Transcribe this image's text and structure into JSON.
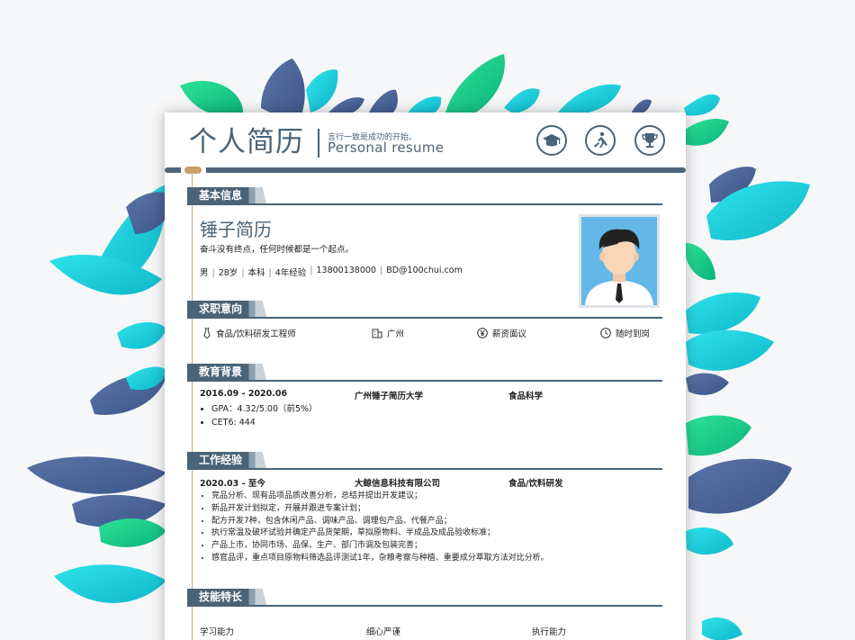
{
  "header": {
    "title_cn": "个人简历",
    "motto": "言行一致是成功的开始。",
    "title_en": "Personal resume",
    "badges": [
      "graduation-cap-icon",
      "runner-icon",
      "trophy-icon"
    ]
  },
  "sections": {
    "basic": "基本信息",
    "intent": "求职意向",
    "education": "教育背景",
    "work": "工作经验",
    "skills": "技能特长"
  },
  "basic": {
    "name": "锤子简历",
    "slogan": "奋斗没有终点，任何时候都是一个起点。",
    "info": [
      "男",
      "28岁",
      "本科",
      "4年经验",
      "13800138000",
      "BD@100chui.com"
    ]
  },
  "intent": {
    "position": "食品/饮料研发工程师",
    "city": "广州",
    "salary": "薪资面议",
    "availability": "随时到岗"
  },
  "education": {
    "period": "2016.09 - 2020.06",
    "school": "广州锤子简历大学",
    "major": "食品科学",
    "items": [
      "GPA：4.32/5.00（前5%）",
      "CET6: 444"
    ]
  },
  "work": {
    "period": "2020.03 - 至今",
    "company": "大鲸信息科技有限公司",
    "role": "食品/饮料研发",
    "items": [
      "竞品分析、现有品项品质改善分析，总结并提出开发建议；",
      "新品开发计划拟定，开展并跟进专案计划；",
      "配方开发7种，包含休闲产品、调味产品、调理包产品、代餐产品；",
      "执行常温及破坏试验并确定产品货架期，草拟原物料、半成品及成品验收标准；",
      "产品上市，协同市场、品保、生产、部门市调及包装完善；",
      "感官品评，重点项目原物料筛选品评测试1年，杂粮考察与种植、重要成分萃取方法对比分析。"
    ]
  },
  "skills": [
    "学习能力",
    "细心严谨",
    "执行能力"
  ],
  "colors": {
    "primary": "#4a6377",
    "accent": "#c7a06a",
    "teal": "#1ec9d6",
    "green": "#18c98a",
    "navy": "#4b6497"
  }
}
